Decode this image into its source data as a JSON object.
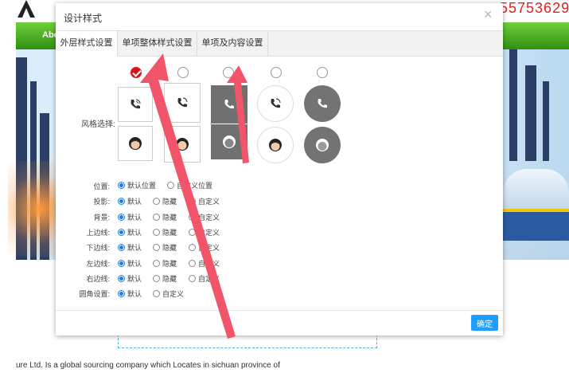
{
  "background": {
    "phone_partial": "55753629",
    "nav_item": "Abo",
    "body_text": "ure Ltd. Is a global sourcing company which Locates in sichuan province of"
  },
  "dialog": {
    "title": "设计样式",
    "close_glyph": "×",
    "tabs": [
      {
        "label": "外层样式设置",
        "active": true
      },
      {
        "label": "单项整体样式设置",
        "active": false
      },
      {
        "label": "单项及内容设置",
        "active": false
      }
    ],
    "style_label": "风格选择:",
    "selected_style_index": 0,
    "form": [
      {
        "label": "位置:",
        "options": [
          "默认位置",
          "自定义位置"
        ],
        "selected": 0
      },
      {
        "label": "投影:",
        "options": [
          "默认",
          "隐藏",
          "自定义"
        ],
        "selected": 0
      },
      {
        "label": "背景:",
        "options": [
          "默认",
          "隐藏",
          "自定义"
        ],
        "selected": 0
      },
      {
        "label": "上边线:",
        "options": [
          "默认",
          "隐藏",
          "自定义"
        ],
        "selected": 0
      },
      {
        "label": "下边线:",
        "options": [
          "默认",
          "隐藏",
          "自定义"
        ],
        "selected": 0
      },
      {
        "label": "左边线:",
        "options": [
          "默认",
          "隐藏",
          "自定义"
        ],
        "selected": 0
      },
      {
        "label": "右边线:",
        "options": [
          "默认",
          "隐藏",
          "自定义"
        ],
        "selected": 0
      },
      {
        "label": "圆角设置:",
        "options": [
          "默认",
          "自定义"
        ],
        "selected": 0
      }
    ],
    "ok_label": "确定"
  },
  "colors": {
    "accent_blue": "#1e9fff",
    "check_red": "#d9161c",
    "arrow_pink": "#f2546a"
  },
  "icons": {
    "phone": "phone-icon",
    "avatar": "avatar-icon"
  }
}
